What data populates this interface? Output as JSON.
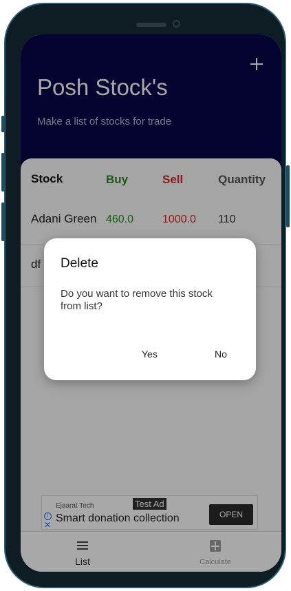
{
  "app": {
    "title": "Posh Stock's",
    "subtitle": "Make a list of stocks for trade",
    "add_icon": "plus-icon"
  },
  "table": {
    "headers": {
      "stock": "Stock",
      "buy": "Buy",
      "sell": "Sell",
      "quantity": "Quantity"
    },
    "rows": [
      {
        "stock": "Adani Green",
        "buy": "460.0",
        "sell": "1000.0",
        "quantity": "110"
      },
      {
        "stock": "df",
        "buy": "",
        "sell": "",
        "quantity": ""
      }
    ],
    "colors": {
      "buy": "#2c8a2c",
      "sell": "#d42a2a"
    }
  },
  "ad": {
    "advertiser": "Ejaarat Tech",
    "badge": "Test Ad",
    "headline": "Smart donation collection",
    "cta": "OPEN"
  },
  "bottom_nav": {
    "items": [
      {
        "label": "List",
        "icon": "list-icon"
      },
      {
        "label": "Calculate",
        "icon": "calculator-icon"
      }
    ]
  },
  "dialog": {
    "title": "Delete",
    "message": "Do you want to remove this stock from list?",
    "yes": "Yes",
    "no": "No"
  },
  "colors": {
    "header_bg": "#08074a",
    "frame": "#0e1d24"
  }
}
